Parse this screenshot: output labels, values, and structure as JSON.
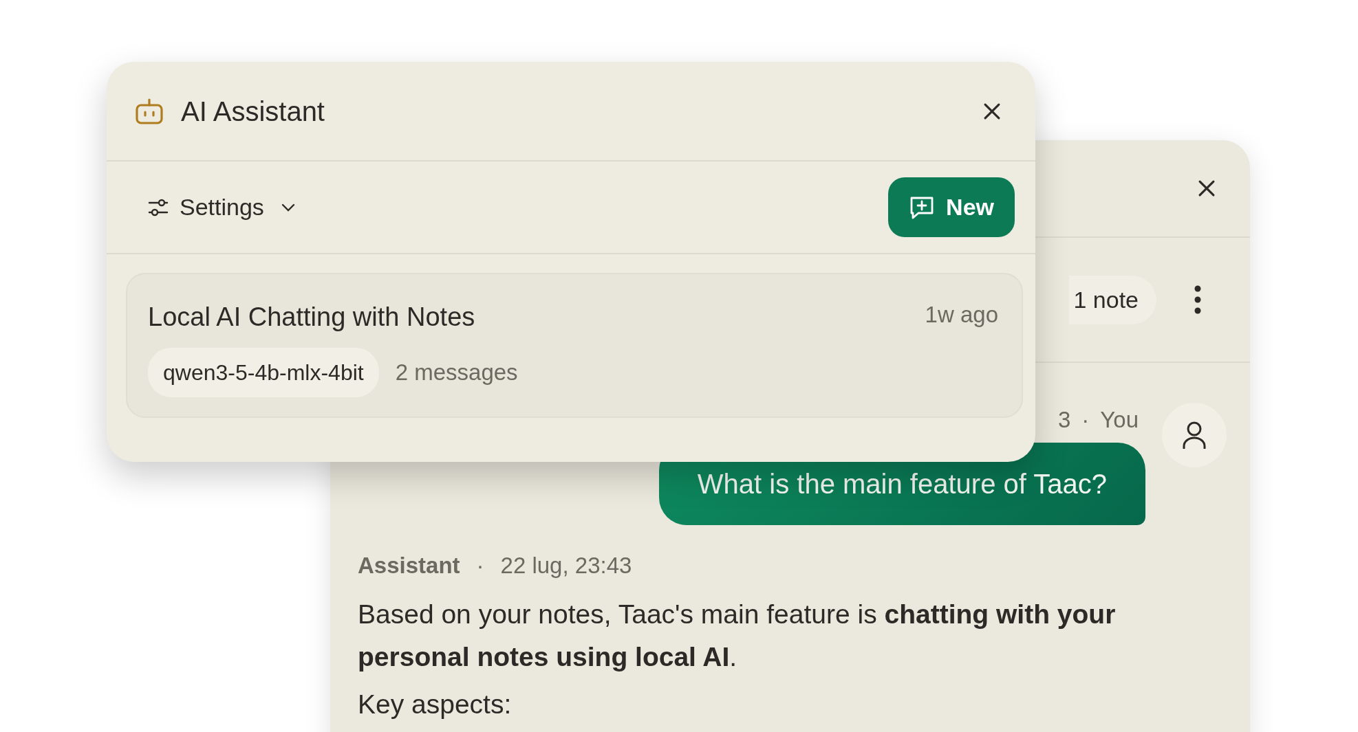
{
  "chat_window": {
    "context_chip": "1 note",
    "messages": [
      {
        "kind": "user",
        "time": "3",
        "separator": "·",
        "author": "You",
        "text": "What is the main feature of Taac?"
      },
      {
        "kind": "assistant",
        "author": "Assistant",
        "separator": "·",
        "time": "22 lug, 23:43",
        "paragraphs": [
          "Based on your notes, Taac's main feature is **chatting with your personal notes using local AI**.",
          "Key aspects:"
        ]
      }
    ]
  },
  "assistant_panel": {
    "title": "AI Assistant",
    "settings_label": "Settings",
    "new_button": "New",
    "conversations": [
      {
        "title": "Local AI Chatting with Notes",
        "time": "1w ago",
        "model": "qwen3-5-4b-mlx-4bit",
        "count": "2 messages"
      }
    ]
  }
}
